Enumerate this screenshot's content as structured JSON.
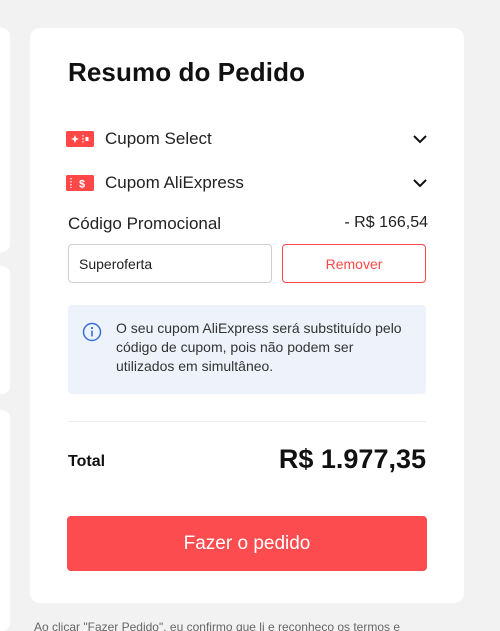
{
  "order_summary": {
    "title": "Resumo do Pedido",
    "coupons": [
      {
        "label": "Cupom Select",
        "icon": "coupon-select-icon"
      },
      {
        "label": "Cupom AliExpress",
        "icon": "coupon-aliexpress-icon"
      }
    ],
    "promo": {
      "label": "Código Promocional",
      "discount": "- R$ 166,54",
      "input_value": "Superoferta",
      "remove_label": "Remover"
    },
    "info_message": "O seu cupom AliExpress será substituído pelo código de cupom, pois não podem ser utilizados em simultâneo.",
    "total": {
      "label": "Total",
      "value": "R$ 1.977,35"
    },
    "order_button_label": "Fazer o pedido",
    "footnote": "Ao clicar \"Fazer Pedido\", eu confirmo que li e reconheço os termos e"
  },
  "colors": {
    "accent": "#fd4c4f",
    "info_bg": "#eef3fb",
    "info_icon": "#3a6fd8"
  }
}
